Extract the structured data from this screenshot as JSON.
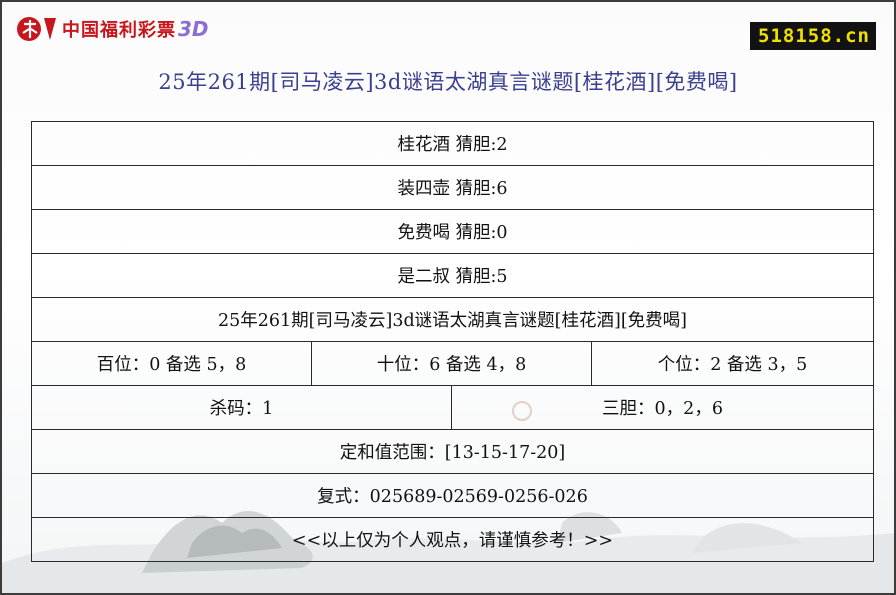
{
  "header": {
    "logo_text": "中国福利彩票",
    "logo_suffix": "3D",
    "site_badge": "518158.cn"
  },
  "title": "25年261期[司马凌云]3d谜语太湖真言谜题[桂花酒][免费喝]",
  "table": {
    "rows_single": [
      "桂花酒 猜胆:2",
      "装四壶 猜胆:6",
      "免费喝 猜胆:0",
      "是二叔 猜胆:5",
      "25年261期[司马凌云]3d谜语太湖真言谜题[桂花酒][免费喝]"
    ],
    "positions": [
      "百位：0 备选 5，8",
      "十位：6 备选 4，8",
      "个位：2 备选 3，5"
    ],
    "kill_code": "杀码：1",
    "three_dan": "三胆：0，2，6",
    "sum_range": "定和值范围：[13-15-17-20]",
    "compound": "复式：025689-02569-0256-026",
    "footer": "<<以上仅为个人观点，请谨慎参考！>>"
  },
  "colors": {
    "title": "#3a3f8f",
    "logo_red": "#c8161d",
    "badge_bg": "#121212",
    "badge_text": "#f0e000"
  }
}
